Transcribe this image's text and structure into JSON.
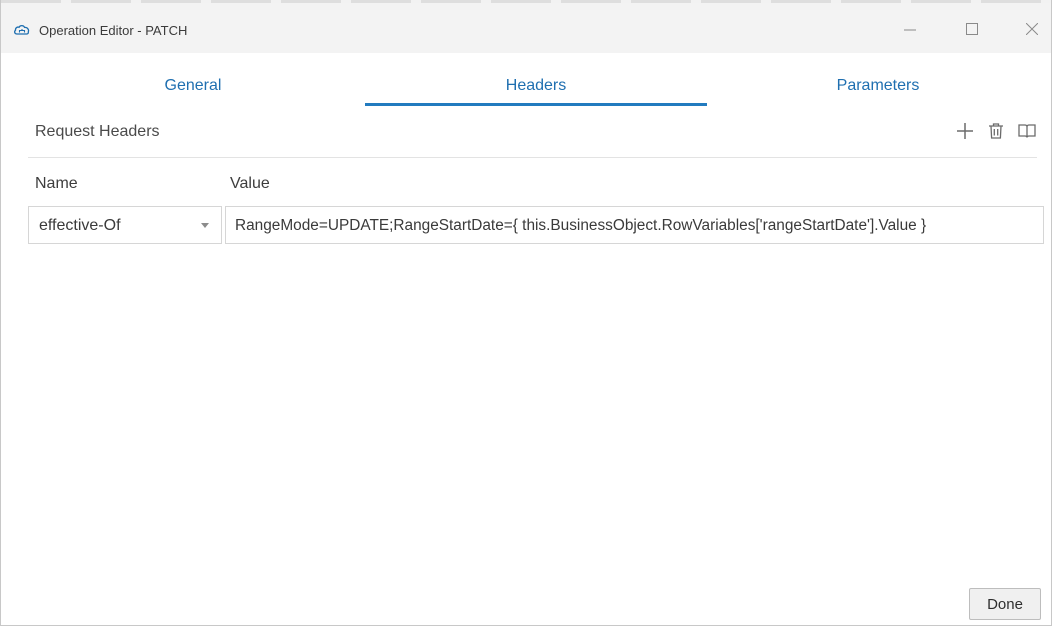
{
  "window": {
    "title": "Operation Editor - PATCH",
    "icon": "cloud-network-icon",
    "controls": [
      "minimize-icon",
      "maximize-icon",
      "close-icon"
    ]
  },
  "tabs": {
    "items": [
      {
        "label": "General"
      },
      {
        "label": "Headers"
      },
      {
        "label": "Parameters"
      }
    ],
    "active": "Headers"
  },
  "request_headers": {
    "title": "Request Headers",
    "actions": [
      "add-icon",
      "delete-icon",
      "book-icon"
    ],
    "columns": {
      "name": "Name",
      "value": "Value"
    },
    "rows": [
      {
        "name": "effective-Of",
        "value": "RangeMode=UPDATE;RangeStartDate={ this.BusinessObject.RowVariables['rangeStartDate'].Value }"
      }
    ]
  },
  "footer": {
    "done_label": "Done"
  },
  "colors": {
    "accent": "#227bbf",
    "tab_text": "#1f6fb0",
    "titlebar_bg": "#f3f3f3"
  }
}
